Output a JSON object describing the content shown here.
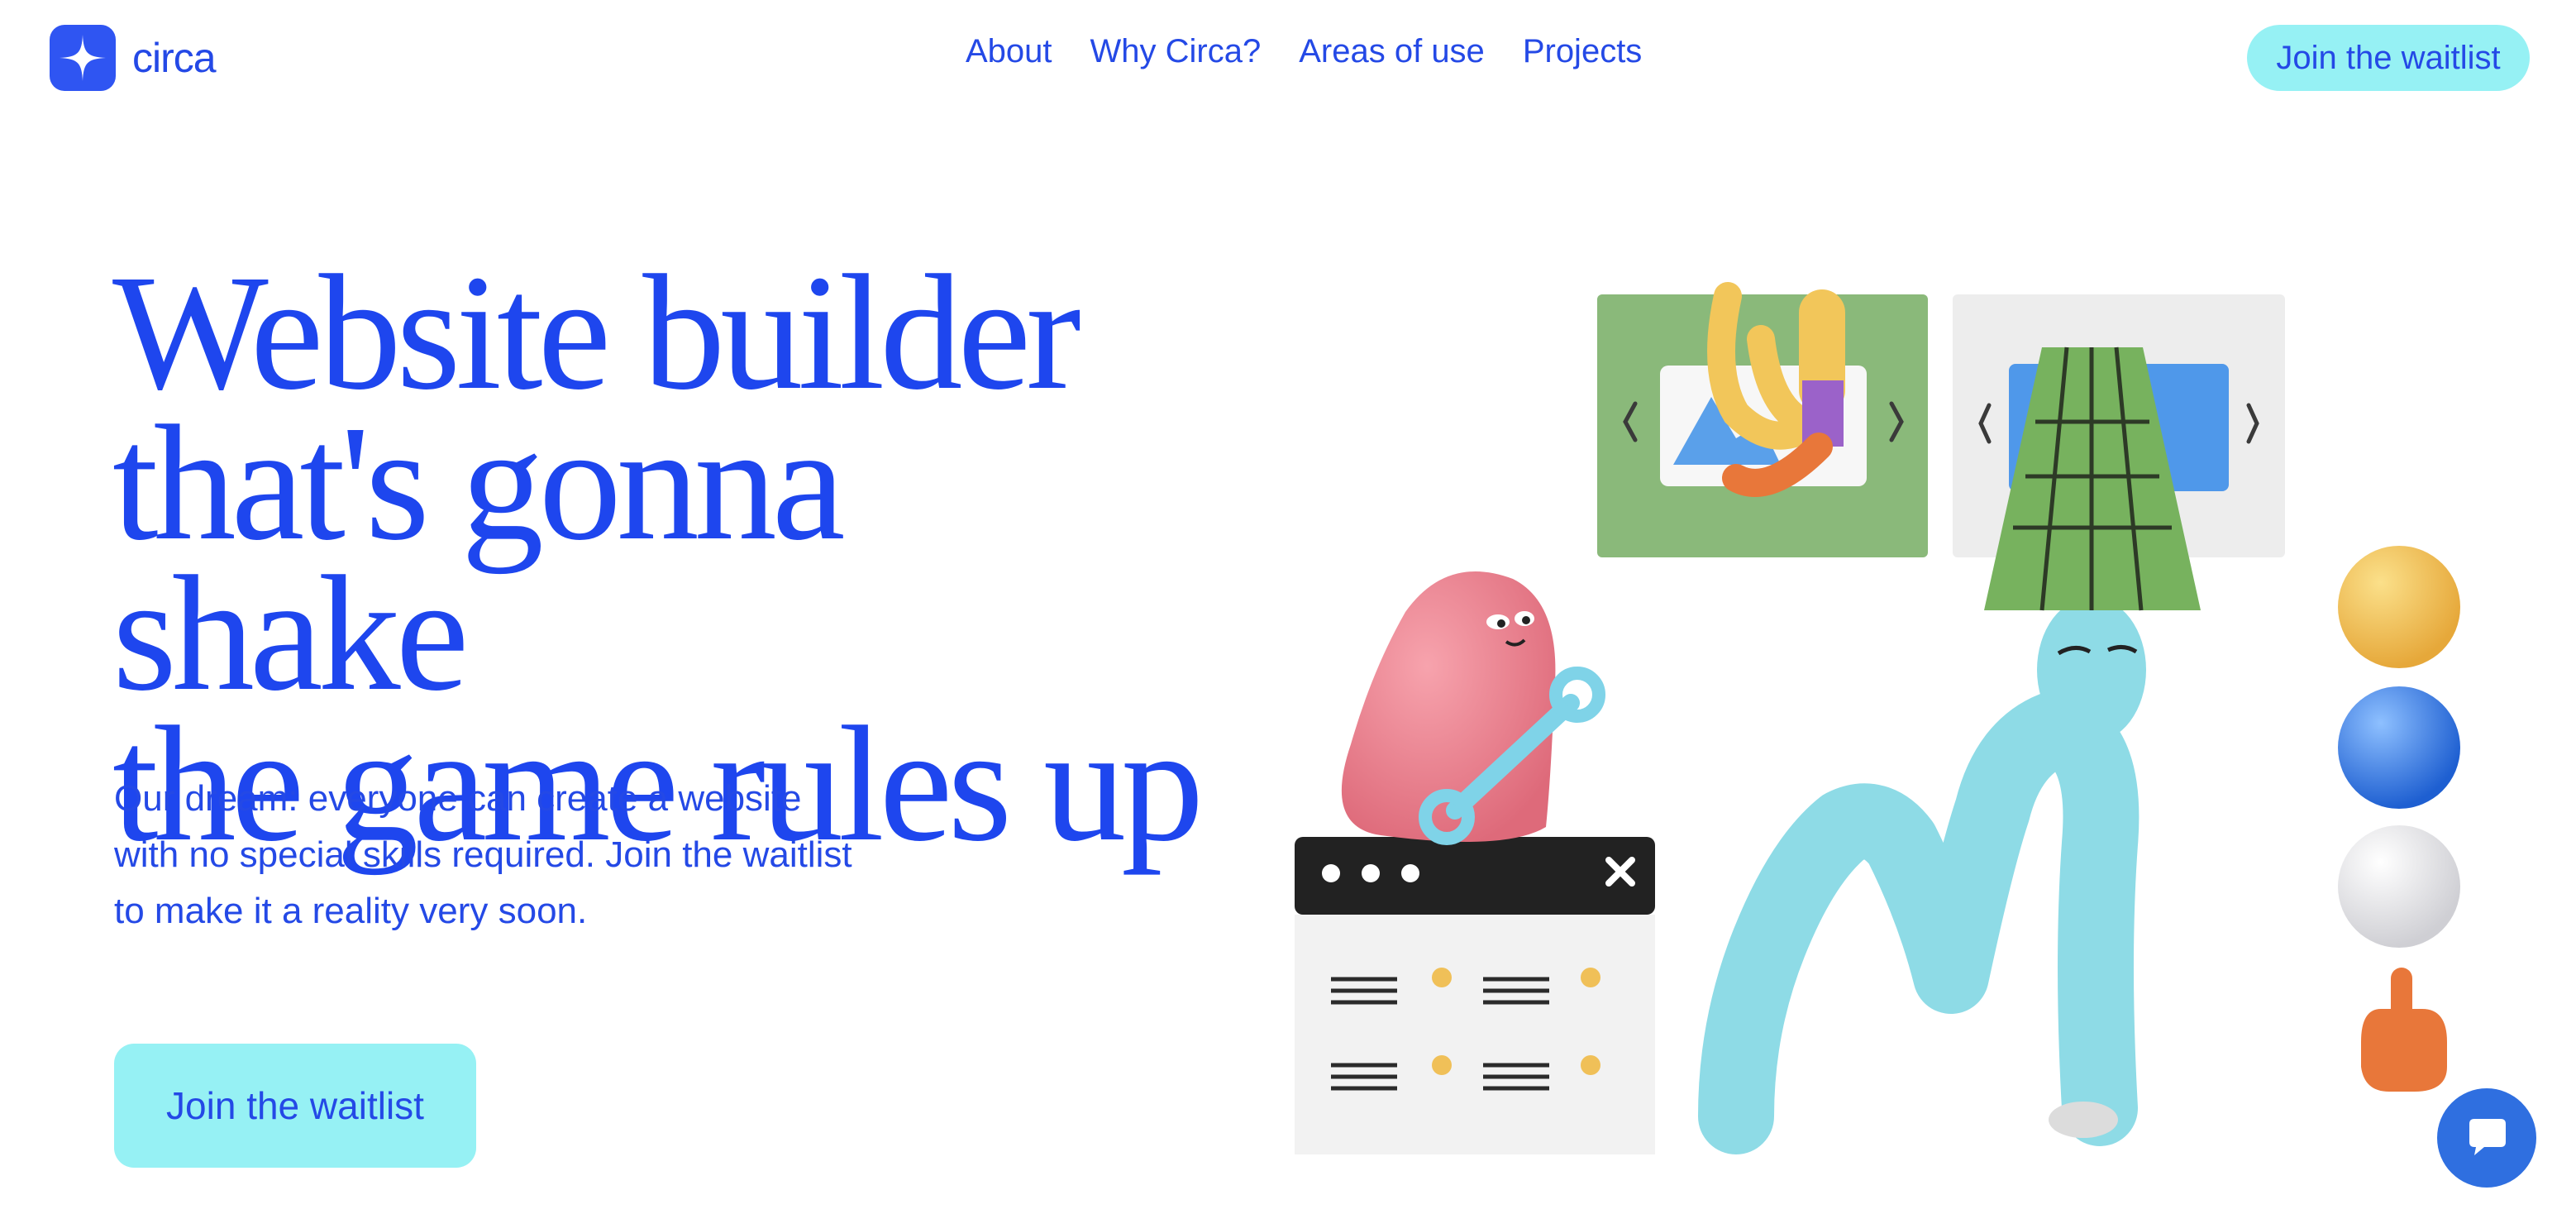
{
  "brand": {
    "name": "circa",
    "logo_icon": "four-point-star-icon",
    "color": "#2f55f2"
  },
  "nav": {
    "items": [
      {
        "label": "About"
      },
      {
        "label": "Why Circa?"
      },
      {
        "label": "Areas of use"
      },
      {
        "label": "Projects"
      }
    ]
  },
  "header_cta": {
    "label": "Join the waitlist"
  },
  "hero": {
    "title_lines": [
      "Website builder",
      "that's gonna shake",
      "the game rules up"
    ],
    "subtitle_lines": [
      "Our dream: everyone can create a website",
      "with no special skills required. Join the waitlist",
      "to make it a reality very soon."
    ],
    "cta_label": "Join the waitlist"
  },
  "colors": {
    "accent": "#2449e6",
    "cta_bg": "#96f1f4",
    "chat": "#2f6fe0"
  },
  "chat": {
    "icon": "chat-bubble-icon"
  }
}
